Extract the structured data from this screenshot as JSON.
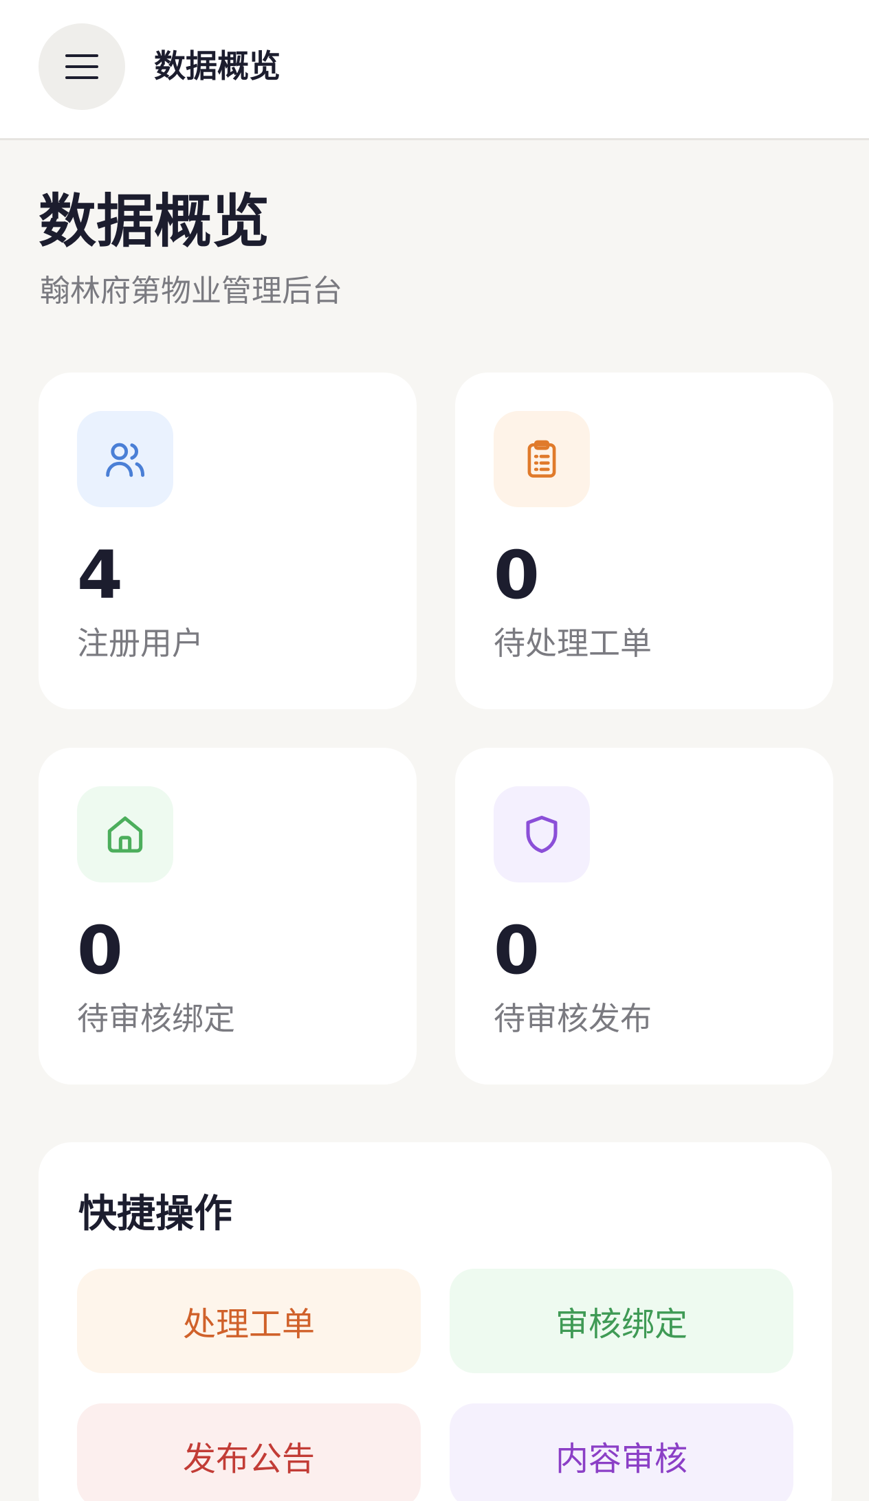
{
  "header": {
    "title": "数据概览",
    "menu_icon": "menu-icon"
  },
  "page": {
    "title": "数据概览",
    "subtitle": "翰林府第物业管理后台"
  },
  "stats": [
    {
      "value": "4",
      "label": "注册用户",
      "icon": "users-icon",
      "icon_color": "#4a7fd6",
      "icon_bg": "#eaf2fe"
    },
    {
      "value": "0",
      "label": "待处理工单",
      "icon": "clipboard-icon",
      "icon_color": "#e07a2b",
      "icon_bg": "#fef3e8"
    },
    {
      "value": "0",
      "label": "待审核绑定",
      "icon": "home-icon",
      "icon_color": "#4cae5c",
      "icon_bg": "#eefaf0"
    },
    {
      "value": "0",
      "label": "待审核发布",
      "icon": "shield-icon",
      "icon_color": "#8b4fd8",
      "icon_bg": "#f4f0fe"
    }
  ],
  "quick_actions": {
    "title": "快捷操作",
    "items": [
      {
        "label": "处理工单",
        "text_color": "#d0612a",
        "bg": "#fef5eb"
      },
      {
        "label": "审核绑定",
        "text_color": "#3f9a55",
        "bg": "#eefaf0"
      },
      {
        "label": "发布公告",
        "text_color": "#c23c36",
        "bg": "#fcefee"
      },
      {
        "label": "内容审核",
        "text_color": "#8b3fc6",
        "bg": "#f5f1fd"
      }
    ]
  }
}
